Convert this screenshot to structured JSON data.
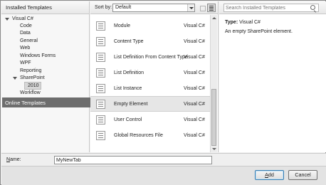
{
  "left_pane": {
    "header": "Installed Templates",
    "tree": [
      {
        "label": "Visual C#",
        "expanded": true
      },
      {
        "label": "Code"
      },
      {
        "label": "Data"
      },
      {
        "label": "General"
      },
      {
        "label": "Web"
      },
      {
        "label": "Windows Forms"
      },
      {
        "label": "WPF"
      },
      {
        "label": "Reporting"
      },
      {
        "label": "SharePoint",
        "expanded": true
      },
      {
        "label": "2010",
        "selected": true
      },
      {
        "label": "Workflow"
      }
    ],
    "online_templates": "Online Templates"
  },
  "toolbar": {
    "sort_by_label": "Sort by:",
    "sort_by_value": "Default"
  },
  "templates": [
    {
      "name": "Module",
      "language": "Visual C#"
    },
    {
      "name": "Content Type",
      "language": "Visual C#"
    },
    {
      "name": "List Definition From Content Type",
      "language": "Visual C#"
    },
    {
      "name": "List Definition",
      "language": "Visual C#"
    },
    {
      "name": "List Instance",
      "language": "Visual C#"
    },
    {
      "name": "Empty Element",
      "language": "Visual C#",
      "selected": true
    },
    {
      "name": "User Control",
      "language": "Visual C#"
    },
    {
      "name": "Global Resources File",
      "language": "Visual C#"
    }
  ],
  "details": {
    "search_placeholder": "Search Installed Templates",
    "type_label": "Type:",
    "type_value": "Visual C#",
    "description": "An empty SharePoint element."
  },
  "name_field": {
    "label_accel": "N",
    "label_rest": "ame:",
    "value": "MyNewTab"
  },
  "buttons": {
    "add_accel": "A",
    "add_rest": "dd",
    "cancel": "Cancel"
  }
}
